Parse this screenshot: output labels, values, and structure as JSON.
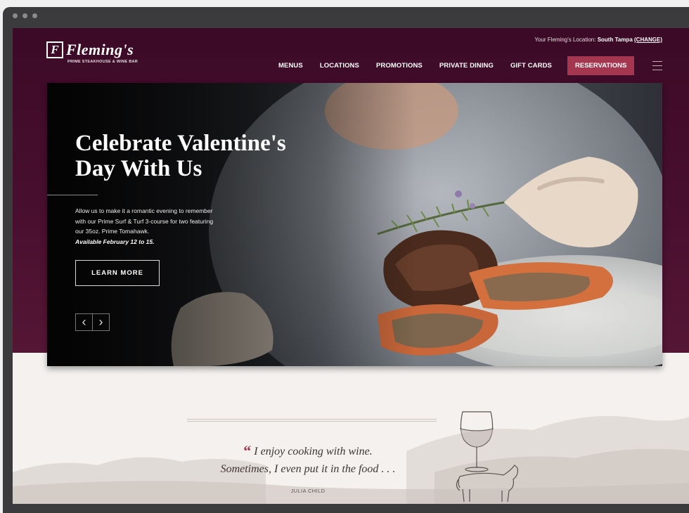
{
  "brand": {
    "name": "Fleming's",
    "mark": "F",
    "tagline": "PRIME STEAKHOUSE & WINE BAR"
  },
  "location": {
    "prefix": "Your Fleming's Location:",
    "current": "South Tampa",
    "change_label": "(CHANGE)"
  },
  "nav": {
    "items": [
      {
        "label": "MENUS"
      },
      {
        "label": "LOCATIONS"
      },
      {
        "label": "PROMOTIONS"
      },
      {
        "label": "PRIVATE DINING"
      },
      {
        "label": "GIFT CARDS"
      }
    ],
    "reservations_label": "RESERVATIONS"
  },
  "hero": {
    "title_line1": "Celebrate Valentine's",
    "title_line2": "Day With Us",
    "body_line1": "Allow us to make it a romantic evening to remember",
    "body_line2": "with our Prime Surf & Turf 3-course for two featuring",
    "body_line3": "our 35oz. Prime Tomahawk.",
    "availability": "Available February 12 to 15.",
    "cta_label": "LEARN MORE",
    "prev_glyph": "‹",
    "next_glyph": "›"
  },
  "quote": {
    "mark": "“",
    "line1": "I enjoy cooking with wine.",
    "line2": "Sometimes, I even put it in the food . . .",
    "author": "JULIA CHILD"
  },
  "colors": {
    "header_bg": "#4a0f2f",
    "accent": "#a4364f",
    "page_bg": "#f4f1ef",
    "frame": "#3b3b3d"
  }
}
